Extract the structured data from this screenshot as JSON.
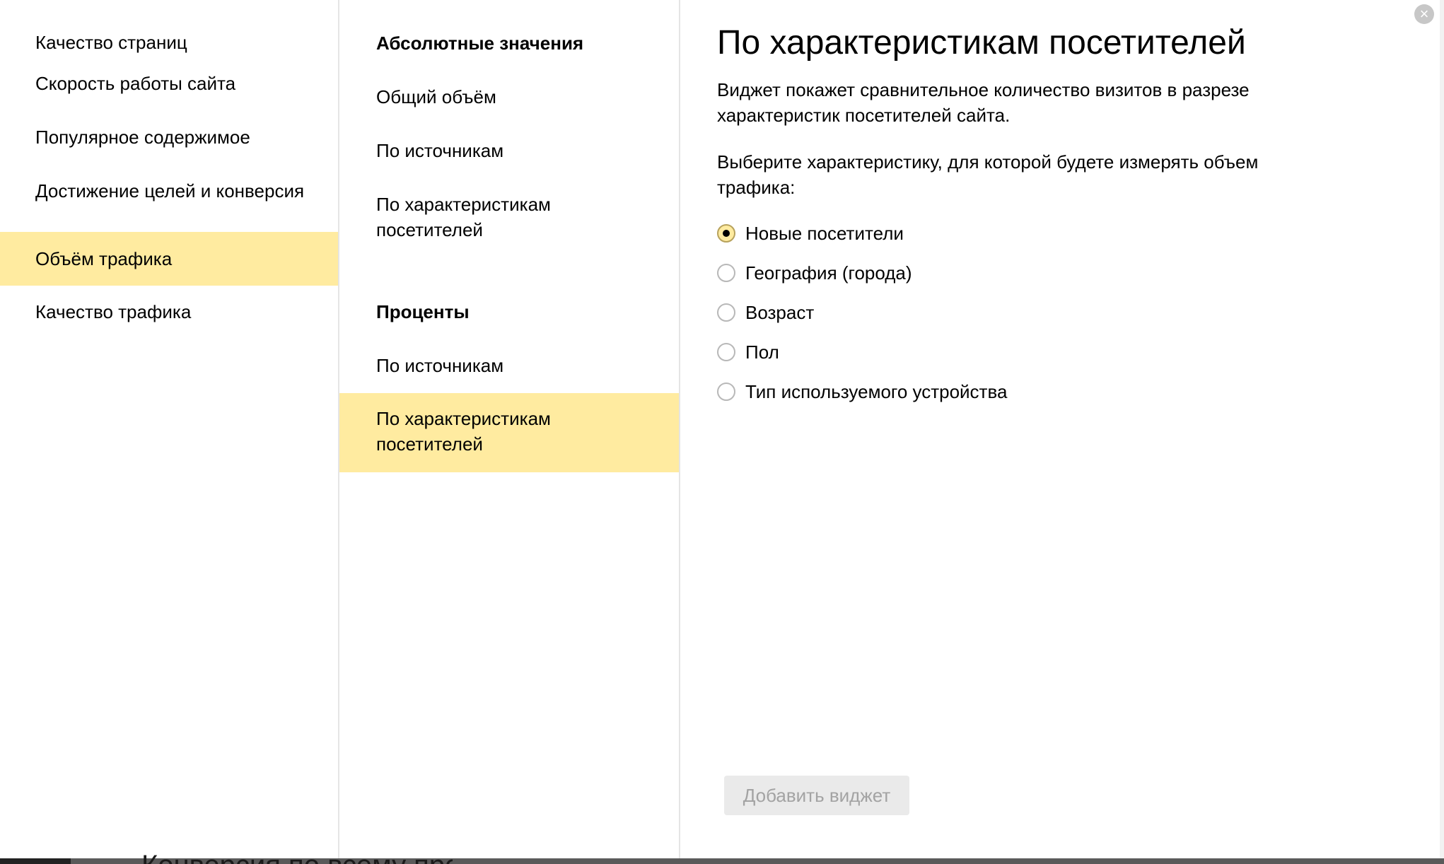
{
  "left_nav": {
    "items": [
      {
        "label": "Качество страниц",
        "selected": false
      },
      {
        "label": "Скорость работы сайта",
        "selected": false
      },
      {
        "label": "Популярное содержимое",
        "selected": false
      },
      {
        "label": "Достижение целей и конверсия",
        "selected": false
      },
      {
        "label": "Объём трафика",
        "selected": true
      },
      {
        "label": "Качество трафика",
        "selected": false
      }
    ]
  },
  "mid_nav": {
    "absolute_heading": "Абсолютные значения",
    "absolute_items": [
      {
        "label": "Общий объём",
        "selected": false
      },
      {
        "label": "По источникам",
        "selected": false
      },
      {
        "label": "По характеристикам посетителей",
        "selected": false
      }
    ],
    "percent_heading": "Проценты",
    "percent_items": [
      {
        "label": "По источникам",
        "selected": false
      },
      {
        "label": "По характеристикам посетителей",
        "selected": true
      }
    ]
  },
  "detail": {
    "title": "По характеристикам посетителей",
    "description": "Виджет покажет сравнительное количество визитов в разрезе характеристик посетителей сайта.",
    "prompt": "Выберите характеристику, для которой будете измерять объем трафика:",
    "options": [
      {
        "label": "Новые посетители",
        "checked": true
      },
      {
        "label": "География (города)",
        "checked": false
      },
      {
        "label": "Возраст",
        "checked": false
      },
      {
        "label": "Пол",
        "checked": false
      },
      {
        "label": "Тип используемого устройства",
        "checked": false
      }
    ],
    "add_button_label": "Добавить виджет"
  },
  "close_glyph": "×",
  "background_text": "Конверсия по всему прое",
  "colors": {
    "selected_bg": "#ffeba0",
    "divider": "#e5e5e5",
    "disabled_button_bg": "#eaeaea",
    "disabled_button_text": "#a3a3a3"
  }
}
